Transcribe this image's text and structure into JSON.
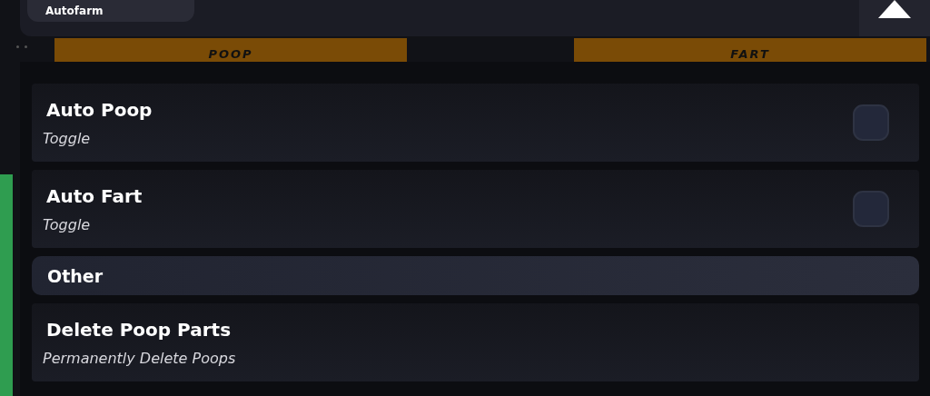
{
  "top_bar": {
    "button": "Autofarm"
  },
  "banners": [
    {
      "label": "POOP"
    },
    {
      "label": "FART"
    }
  ],
  "items": [
    {
      "kind": "toggle",
      "title": "Auto Poop",
      "subtitle": "Toggle",
      "checked": false
    },
    {
      "kind": "toggle",
      "title": "Auto Fart",
      "subtitle": "Toggle",
      "checked": false
    },
    {
      "kind": "section",
      "title": "Other"
    },
    {
      "kind": "button",
      "title": "Delete Poop Parts",
      "subtitle": "Permanently Delete Poops"
    }
  ]
}
